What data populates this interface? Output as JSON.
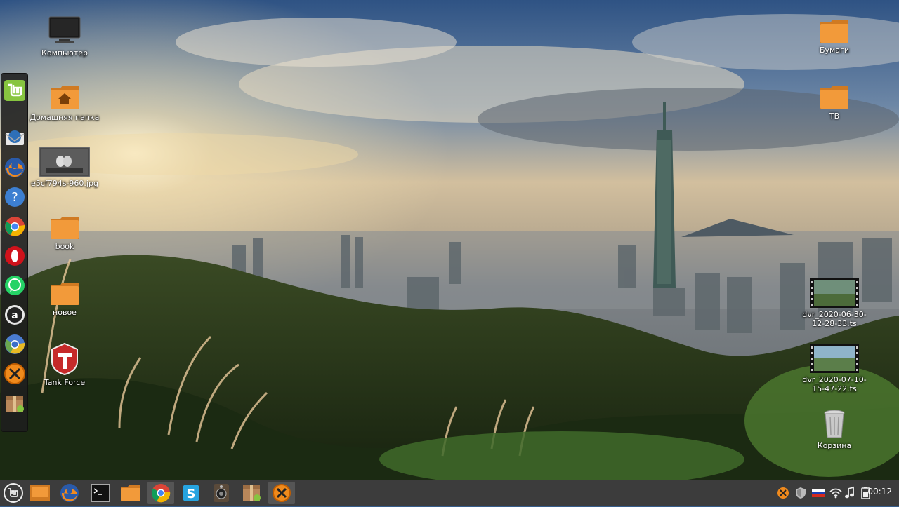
{
  "desktop": {
    "left_icons": [
      {
        "label": "Компьютер",
        "icon": "computer-icon"
      },
      {
        "label": "Домашняя папка",
        "icon": "home-folder-icon"
      },
      {
        "label": "e5cf794s-960.jpg",
        "icon": "image-file-icon"
      },
      {
        "label": "book",
        "icon": "folder-icon"
      },
      {
        "label": "новое",
        "icon": "folder-icon"
      },
      {
        "label": "Tank Force",
        "icon": "tank-force-icon"
      }
    ],
    "right_icons": [
      {
        "label": "Бумаги",
        "icon": "folder-icon"
      },
      {
        "label": "ТВ",
        "icon": "folder-icon"
      },
      {
        "label": "dvr_2020-06-30-12-28-33.ts",
        "icon": "video-file-icon"
      },
      {
        "label": "dvr_2020-07-10-15-47-22.ts",
        "icon": "video-file-icon"
      },
      {
        "label": "Корзина",
        "icon": "trash-icon"
      }
    ]
  },
  "dock": {
    "items": [
      "mint-menu-icon",
      "thunderbird-icon",
      "firefox-icon",
      "help-icon",
      "chrome-icon",
      "opera-icon",
      "whatsapp-icon",
      "amazon-icon",
      "chromium-icon",
      "xbox-icon",
      "archive-icon"
    ]
  },
  "taskbar": {
    "apps": [
      "mint-menu-icon",
      "show-desktop-icon",
      "firefox-icon",
      "terminal-icon",
      "file-manager-icon",
      "chrome-icon",
      "skype-icon",
      "speaker-app-icon",
      "archive-manager-icon",
      "xbox-icon"
    ],
    "tray": [
      "xbox-tray-icon",
      "shield-icon",
      "russian-flag-icon",
      "wifi-icon",
      "music-note-icon",
      "battery-icon"
    ],
    "clock": "00:12"
  },
  "colors": {
    "folder": "#f29a3a",
    "taskbar": "#3c3c3c",
    "mint_green": "#87c540"
  }
}
